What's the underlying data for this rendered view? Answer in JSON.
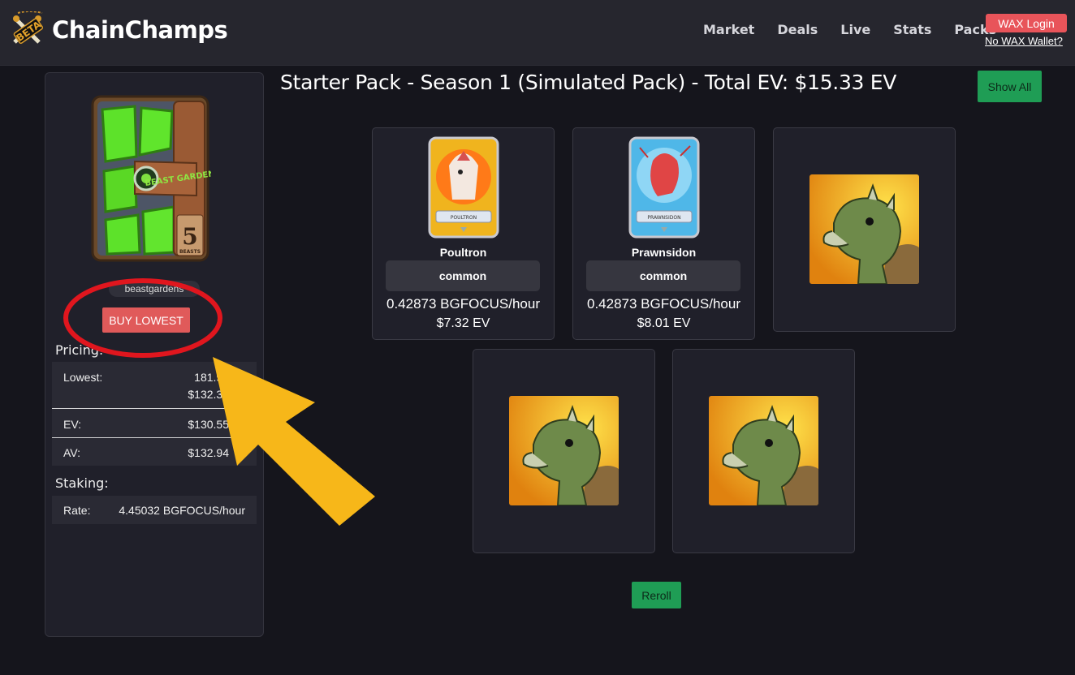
{
  "nav": {
    "brand": "ChainChamps",
    "beta_tag": "BETA",
    "links": [
      "Market",
      "Deals",
      "Live",
      "Stats",
      "Packs"
    ],
    "login_label": "WAX Login",
    "no_wallet_label": "No WAX Wallet?"
  },
  "side": {
    "pack_art_text": "5",
    "pack_art_sub": "BEASTS",
    "pack_art_logo": "BEAST GARDEN",
    "collection": "beastgardens",
    "buy_label": "BUY LOWEST",
    "pricing_title": "Pricing:",
    "pricing": {
      "lowest_label": "Lowest:",
      "lowest_value_1": "181.90",
      "lowest_value_2": "$132.34",
      "ev_label": "EV:",
      "ev_value": "$130.55",
      "av_label": "AV:",
      "av_value": "$132.94"
    },
    "staking_title": "Staking:",
    "staking": {
      "rate_label": "Rate:",
      "rate_value": "4.45032 BGFOCUS/hour"
    }
  },
  "main": {
    "title": "Starter Pack - Season 1 (Simulated Pack) - Total EV: $15.33 EV",
    "show_all_label": "Show All",
    "cards": [
      {
        "name": "Poultron",
        "art_label": "POULTRON",
        "rarity": "common",
        "rate": "0.42873 BGFOCUS/hour",
        "ev": "$7.32 EV"
      },
      {
        "name": "Prawnsidon",
        "art_label": "PRAWNSIDON",
        "rarity": "common",
        "rate": "0.42873 BGFOCUS/hour",
        "ev": "$8.01 EV"
      }
    ],
    "reroll_label": "Reroll"
  },
  "colors": {
    "accent_red": "#e05a5a",
    "accent_green": "#1f9d55",
    "annotation_red": "#e0161e",
    "annotation_arrow": "#f7b719"
  }
}
